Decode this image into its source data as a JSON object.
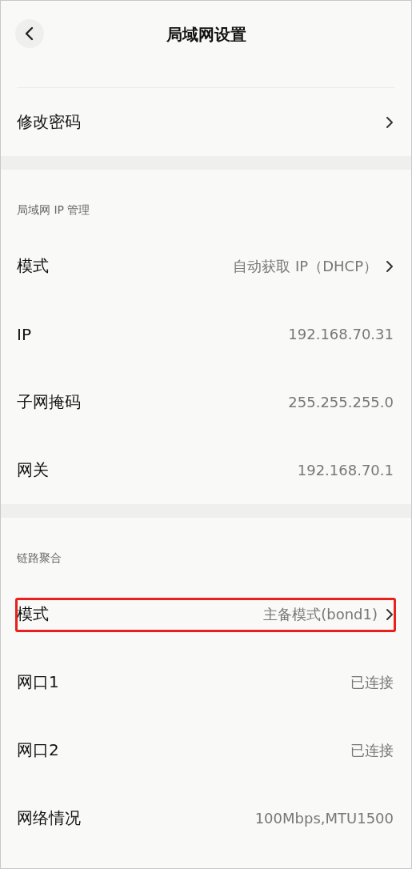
{
  "header": {
    "title": "局域网设置"
  },
  "sections": [
    {
      "rows": [
        {
          "label": "修改密码",
          "has_arrow": true,
          "highlighted": false
        }
      ]
    },
    {
      "title": "局域网 IP 管理",
      "rows": [
        {
          "label": "模式",
          "value": "自动获取 IP（DHCP）",
          "has_arrow": true,
          "highlighted": false
        },
        {
          "label": "IP",
          "value": "192.168.70.31",
          "has_arrow": false,
          "highlighted": false
        },
        {
          "label": "子网掩码",
          "value": "255.255.255.0",
          "has_arrow": false,
          "highlighted": false
        },
        {
          "label": "网关",
          "value": "192.168.70.1",
          "has_arrow": false,
          "highlighted": false
        }
      ]
    },
    {
      "title": "链路聚合",
      "rows": [
        {
          "label": "模式",
          "value": "主备模式(bond1)",
          "has_arrow": true,
          "highlighted": true
        },
        {
          "label": "网口1",
          "value": "已连接",
          "has_arrow": false,
          "highlighted": false
        },
        {
          "label": "网口2",
          "value": "已连接",
          "has_arrow": false,
          "highlighted": false
        },
        {
          "label": "网络情况",
          "value": "100Mbps,MTU1500",
          "has_arrow": false,
          "highlighted": false
        }
      ]
    }
  ]
}
